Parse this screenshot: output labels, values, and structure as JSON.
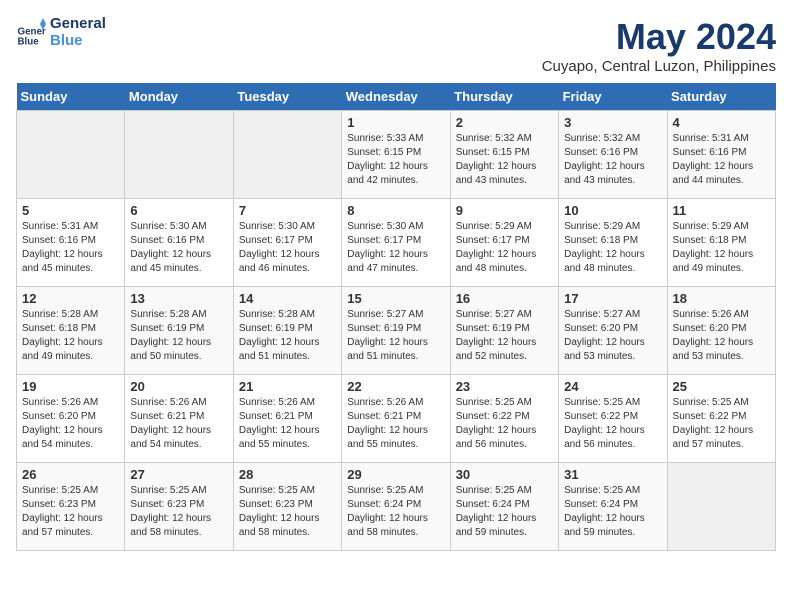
{
  "logo": {
    "line1": "General",
    "line2": "Blue"
  },
  "title": "May 2024",
  "location": "Cuyapo, Central Luzon, Philippines",
  "days_of_week": [
    "Sunday",
    "Monday",
    "Tuesday",
    "Wednesday",
    "Thursday",
    "Friday",
    "Saturday"
  ],
  "weeks": [
    [
      {
        "day": "",
        "sunrise": "",
        "sunset": "",
        "daylight": ""
      },
      {
        "day": "",
        "sunrise": "",
        "sunset": "",
        "daylight": ""
      },
      {
        "day": "",
        "sunrise": "",
        "sunset": "",
        "daylight": ""
      },
      {
        "day": "1",
        "sunrise": "Sunrise: 5:33 AM",
        "sunset": "Sunset: 6:15 PM",
        "daylight": "Daylight: 12 hours and 42 minutes."
      },
      {
        "day": "2",
        "sunrise": "Sunrise: 5:32 AM",
        "sunset": "Sunset: 6:15 PM",
        "daylight": "Daylight: 12 hours and 43 minutes."
      },
      {
        "day": "3",
        "sunrise": "Sunrise: 5:32 AM",
        "sunset": "Sunset: 6:16 PM",
        "daylight": "Daylight: 12 hours and 43 minutes."
      },
      {
        "day": "4",
        "sunrise": "Sunrise: 5:31 AM",
        "sunset": "Sunset: 6:16 PM",
        "daylight": "Daylight: 12 hours and 44 minutes."
      }
    ],
    [
      {
        "day": "5",
        "sunrise": "Sunrise: 5:31 AM",
        "sunset": "Sunset: 6:16 PM",
        "daylight": "Daylight: 12 hours and 45 minutes."
      },
      {
        "day": "6",
        "sunrise": "Sunrise: 5:30 AM",
        "sunset": "Sunset: 6:16 PM",
        "daylight": "Daylight: 12 hours and 45 minutes."
      },
      {
        "day": "7",
        "sunrise": "Sunrise: 5:30 AM",
        "sunset": "Sunset: 6:17 PM",
        "daylight": "Daylight: 12 hours and 46 minutes."
      },
      {
        "day": "8",
        "sunrise": "Sunrise: 5:30 AM",
        "sunset": "Sunset: 6:17 PM",
        "daylight": "Daylight: 12 hours and 47 minutes."
      },
      {
        "day": "9",
        "sunrise": "Sunrise: 5:29 AM",
        "sunset": "Sunset: 6:17 PM",
        "daylight": "Daylight: 12 hours and 48 minutes."
      },
      {
        "day": "10",
        "sunrise": "Sunrise: 5:29 AM",
        "sunset": "Sunset: 6:18 PM",
        "daylight": "Daylight: 12 hours and 48 minutes."
      },
      {
        "day": "11",
        "sunrise": "Sunrise: 5:29 AM",
        "sunset": "Sunset: 6:18 PM",
        "daylight": "Daylight: 12 hours and 49 minutes."
      }
    ],
    [
      {
        "day": "12",
        "sunrise": "Sunrise: 5:28 AM",
        "sunset": "Sunset: 6:18 PM",
        "daylight": "Daylight: 12 hours and 49 minutes."
      },
      {
        "day": "13",
        "sunrise": "Sunrise: 5:28 AM",
        "sunset": "Sunset: 6:19 PM",
        "daylight": "Daylight: 12 hours and 50 minutes."
      },
      {
        "day": "14",
        "sunrise": "Sunrise: 5:28 AM",
        "sunset": "Sunset: 6:19 PM",
        "daylight": "Daylight: 12 hours and 51 minutes."
      },
      {
        "day": "15",
        "sunrise": "Sunrise: 5:27 AM",
        "sunset": "Sunset: 6:19 PM",
        "daylight": "Daylight: 12 hours and 51 minutes."
      },
      {
        "day": "16",
        "sunrise": "Sunrise: 5:27 AM",
        "sunset": "Sunset: 6:19 PM",
        "daylight": "Daylight: 12 hours and 52 minutes."
      },
      {
        "day": "17",
        "sunrise": "Sunrise: 5:27 AM",
        "sunset": "Sunset: 6:20 PM",
        "daylight": "Daylight: 12 hours and 53 minutes."
      },
      {
        "day": "18",
        "sunrise": "Sunrise: 5:26 AM",
        "sunset": "Sunset: 6:20 PM",
        "daylight": "Daylight: 12 hours and 53 minutes."
      }
    ],
    [
      {
        "day": "19",
        "sunrise": "Sunrise: 5:26 AM",
        "sunset": "Sunset: 6:20 PM",
        "daylight": "Daylight: 12 hours and 54 minutes."
      },
      {
        "day": "20",
        "sunrise": "Sunrise: 5:26 AM",
        "sunset": "Sunset: 6:21 PM",
        "daylight": "Daylight: 12 hours and 54 minutes."
      },
      {
        "day": "21",
        "sunrise": "Sunrise: 5:26 AM",
        "sunset": "Sunset: 6:21 PM",
        "daylight": "Daylight: 12 hours and 55 minutes."
      },
      {
        "day": "22",
        "sunrise": "Sunrise: 5:26 AM",
        "sunset": "Sunset: 6:21 PM",
        "daylight": "Daylight: 12 hours and 55 minutes."
      },
      {
        "day": "23",
        "sunrise": "Sunrise: 5:25 AM",
        "sunset": "Sunset: 6:22 PM",
        "daylight": "Daylight: 12 hours and 56 minutes."
      },
      {
        "day": "24",
        "sunrise": "Sunrise: 5:25 AM",
        "sunset": "Sunset: 6:22 PM",
        "daylight": "Daylight: 12 hours and 56 minutes."
      },
      {
        "day": "25",
        "sunrise": "Sunrise: 5:25 AM",
        "sunset": "Sunset: 6:22 PM",
        "daylight": "Daylight: 12 hours and 57 minutes."
      }
    ],
    [
      {
        "day": "26",
        "sunrise": "Sunrise: 5:25 AM",
        "sunset": "Sunset: 6:23 PM",
        "daylight": "Daylight: 12 hours and 57 minutes."
      },
      {
        "day": "27",
        "sunrise": "Sunrise: 5:25 AM",
        "sunset": "Sunset: 6:23 PM",
        "daylight": "Daylight: 12 hours and 58 minutes."
      },
      {
        "day": "28",
        "sunrise": "Sunrise: 5:25 AM",
        "sunset": "Sunset: 6:23 PM",
        "daylight": "Daylight: 12 hours and 58 minutes."
      },
      {
        "day": "29",
        "sunrise": "Sunrise: 5:25 AM",
        "sunset": "Sunset: 6:24 PM",
        "daylight": "Daylight: 12 hours and 58 minutes."
      },
      {
        "day": "30",
        "sunrise": "Sunrise: 5:25 AM",
        "sunset": "Sunset: 6:24 PM",
        "daylight": "Daylight: 12 hours and 59 minutes."
      },
      {
        "day": "31",
        "sunrise": "Sunrise: 5:25 AM",
        "sunset": "Sunset: 6:24 PM",
        "daylight": "Daylight: 12 hours and 59 minutes."
      },
      {
        "day": "",
        "sunrise": "",
        "sunset": "",
        "daylight": ""
      }
    ]
  ]
}
